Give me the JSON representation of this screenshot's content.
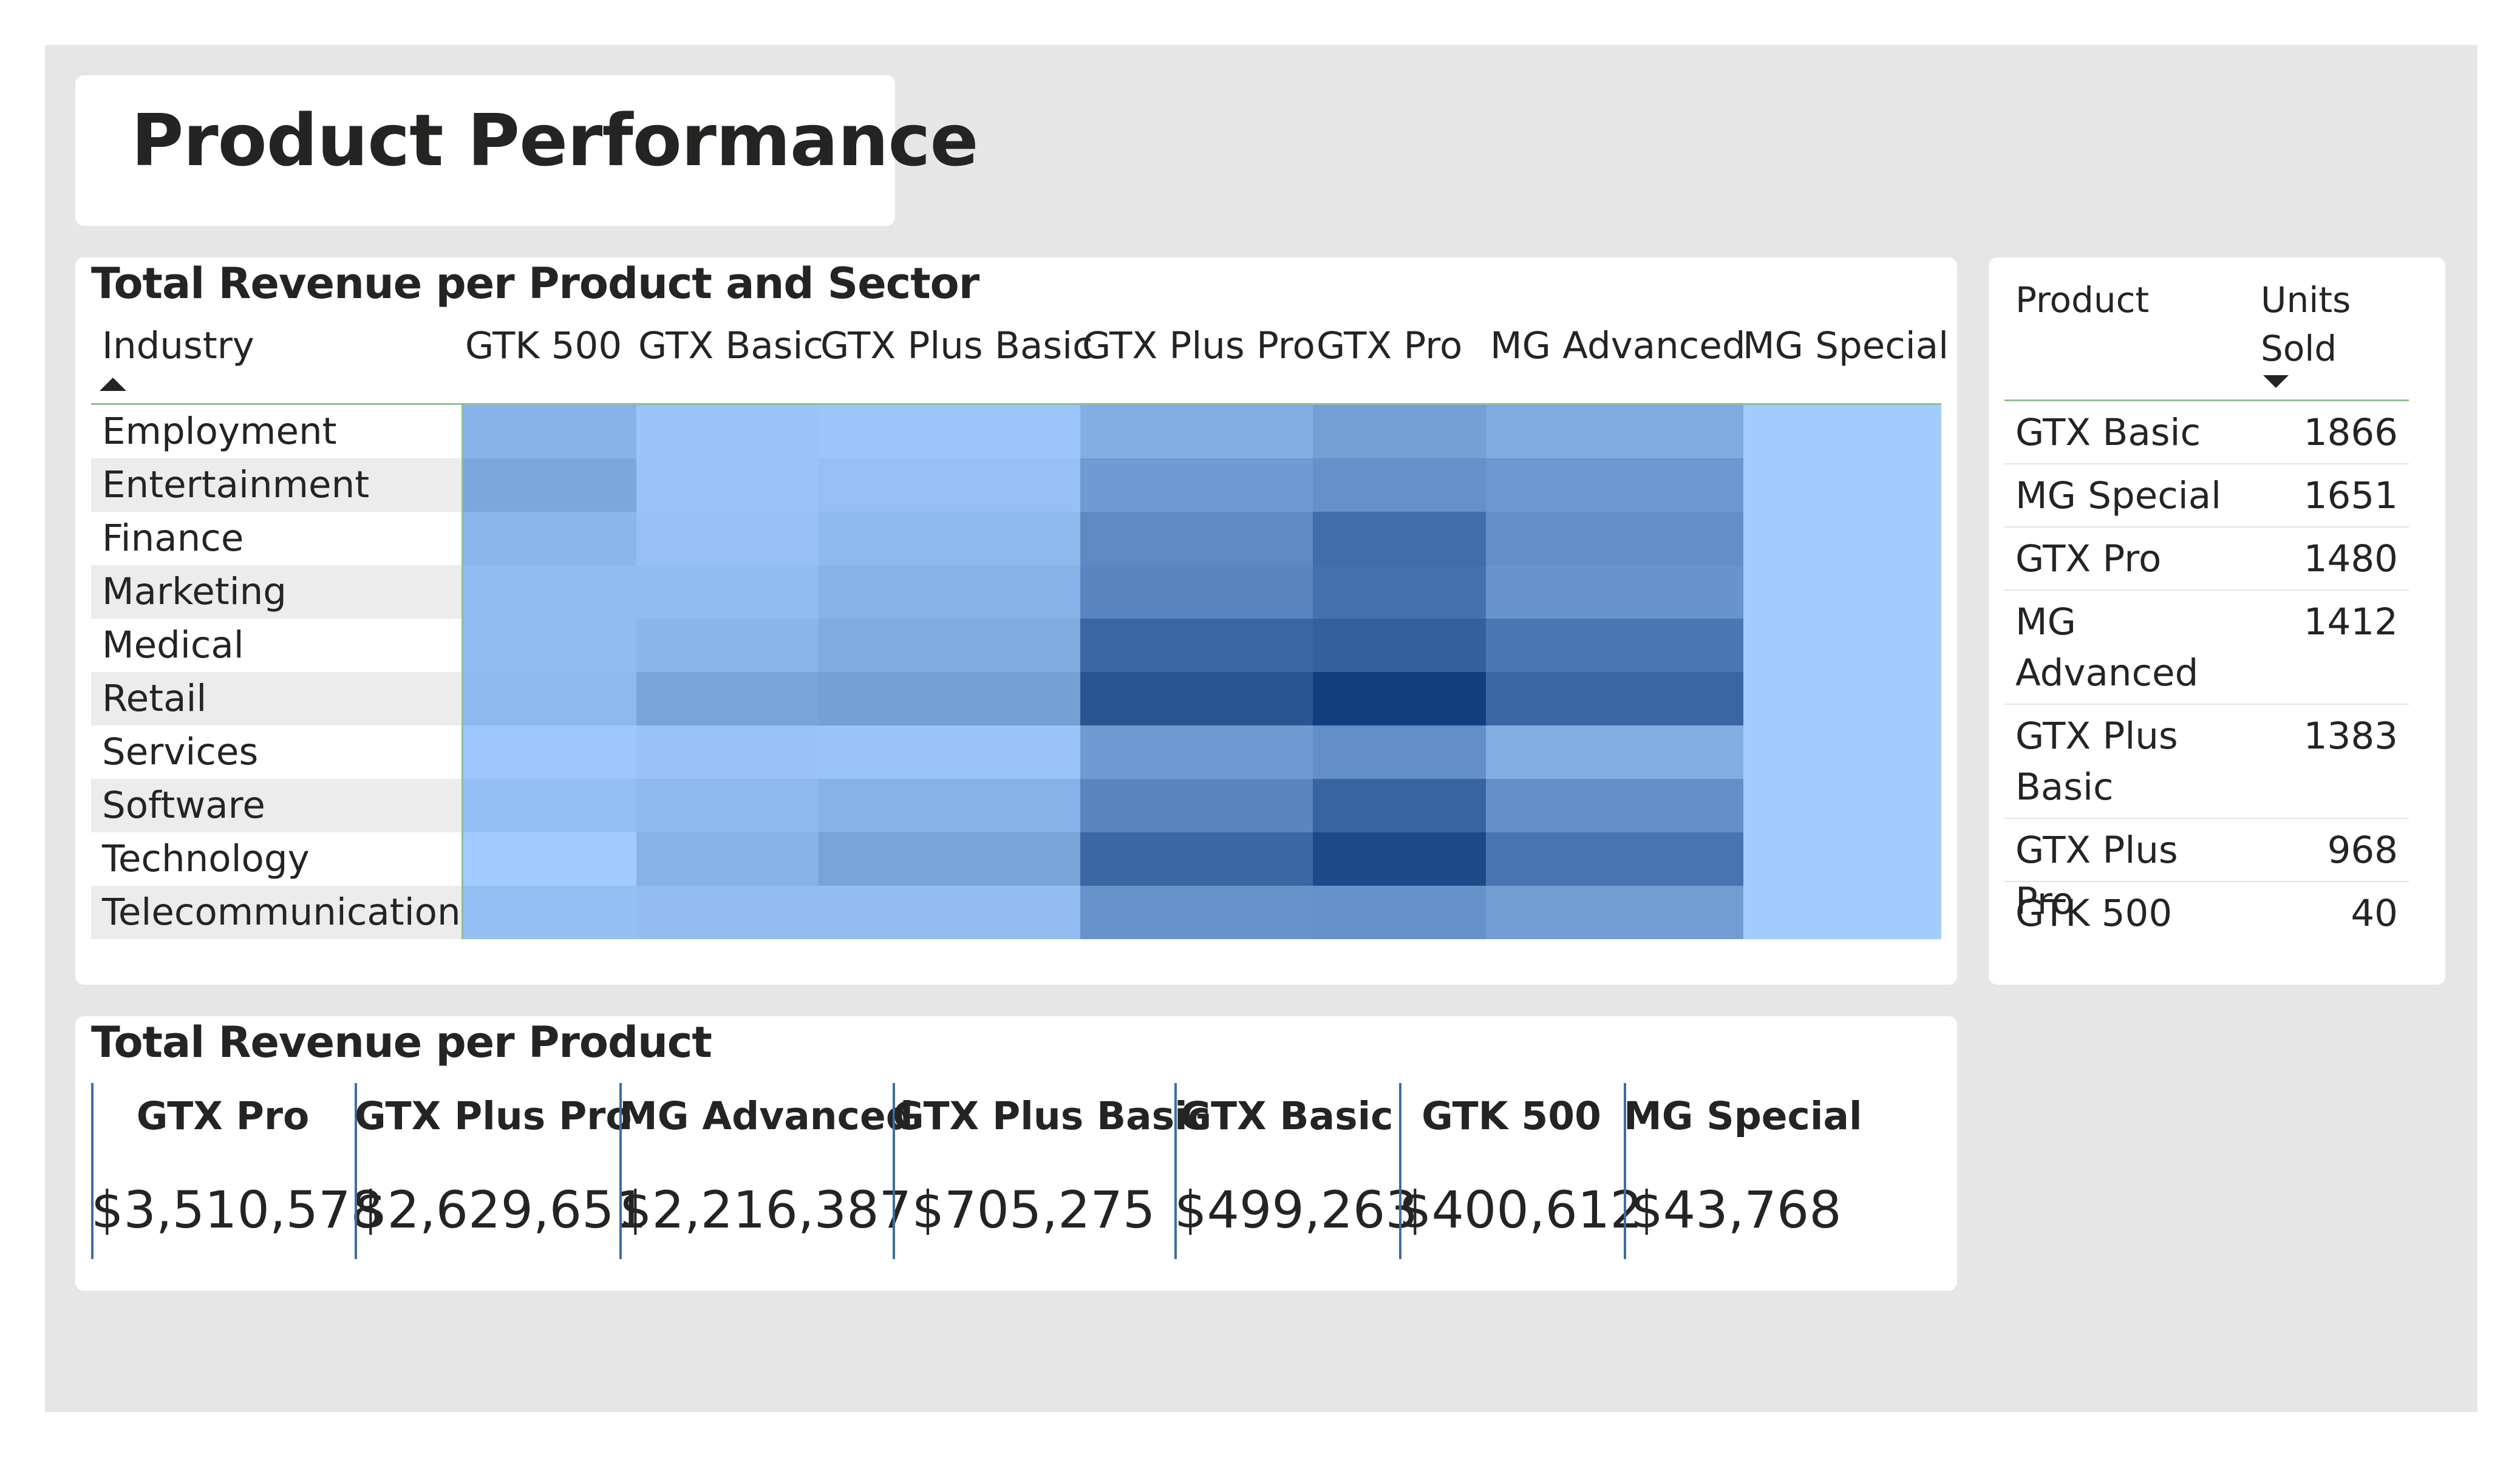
{
  "page": {
    "title": "Product Performance",
    "background": "#e6e6e6"
  },
  "heatmap_card": {
    "title": "Total Revenue per Product and Sector",
    "row_header": "Industry",
    "sort": "ascending by Industry"
  },
  "units_card": {
    "col_product": "Product",
    "col_units_line1": "Units",
    "col_units_line2": "Sold",
    "sort": "descending by Units Sold",
    "rows": [
      {
        "product_lines": [
          "GTX Basic"
        ],
        "units": "1866"
      },
      {
        "product_lines": [
          "MG Special"
        ],
        "units": "1651"
      },
      {
        "product_lines": [
          "GTX Pro"
        ],
        "units": "1480"
      },
      {
        "product_lines": [
          "MG",
          "Advanced"
        ],
        "units": "1412"
      },
      {
        "product_lines": [
          "GTX Plus",
          "Basic"
        ],
        "units": "1383"
      },
      {
        "product_lines": [
          "GTX Plus Pro"
        ],
        "units": "968"
      },
      {
        "product_lines": [
          "GTK 500"
        ],
        "units": "40"
      }
    ]
  },
  "revenue_card": {
    "title": "Total Revenue per Product",
    "items": [
      {
        "product": "GTX Pro",
        "value": "$3,510,578"
      },
      {
        "product": "GTX Plus Pro",
        "value": "$2,629,651"
      },
      {
        "product": "MG Advanced",
        "value": "$2,216,387"
      },
      {
        "product": "GTX Plus Basic",
        "value": "$705,275"
      },
      {
        "product": "GTX Basic",
        "value": "$499,263"
      },
      {
        "product": "GTK 500",
        "value": "$400,612"
      },
      {
        "product": "MG Special",
        "value": "$43,768"
      }
    ]
  },
  "colors": {
    "heat_low": "#a3cdff",
    "heat_high": "#0f3f7f",
    "grid_line": "#8fbf94",
    "separator": "#3d6da3"
  },
  "chart_data": {
    "type": "heatmap",
    "title": "Total Revenue per Product and Sector",
    "row_label": "Industry",
    "rows": [
      "Employment",
      "Entertainment",
      "Finance",
      "Marketing",
      "Medical",
      "Retail",
      "Services",
      "Software",
      "Technology",
      "Telecommunications"
    ],
    "columns": [
      "GTK 500",
      "GTX Basic",
      "GTX Plus Basic",
      "GTX Plus Pro",
      "GTX Pro",
      "MG Advanced",
      "MG Special"
    ],
    "intensity_scale": "relative shade 0 (lightest) to 1 (darkest), estimated",
    "values": [
      [
        0.18,
        0.06,
        0.05,
        0.22,
        0.32,
        0.24,
        0.01
      ],
      [
        0.27,
        0.06,
        0.09,
        0.35,
        0.42,
        0.37,
        0.01
      ],
      [
        0.16,
        0.09,
        0.14,
        0.47,
        0.67,
        0.44,
        0.01
      ],
      [
        0.12,
        0.12,
        0.19,
        0.5,
        0.64,
        0.4,
        0.01
      ],
      [
        0.12,
        0.17,
        0.24,
        0.72,
        0.76,
        0.6,
        0.01
      ],
      [
        0.14,
        0.29,
        0.32,
        0.84,
        1.0,
        0.72,
        0.01
      ],
      [
        0.04,
        0.07,
        0.06,
        0.35,
        0.44,
        0.22,
        0.01
      ],
      [
        0.1,
        0.14,
        0.19,
        0.5,
        0.73,
        0.43,
        0.01
      ],
      [
        0.01,
        0.19,
        0.29,
        0.71,
        0.92,
        0.62,
        0.01
      ],
      [
        0.1,
        0.11,
        0.11,
        0.4,
        0.42,
        0.34,
        0.01
      ]
    ]
  }
}
